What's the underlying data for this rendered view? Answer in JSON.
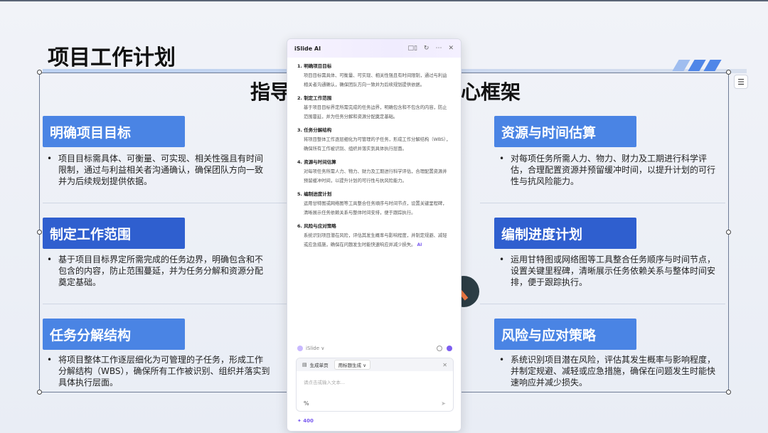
{
  "slide": {
    "title": "项目工作计划",
    "center_title_left": "指导",
    "center_title_right": "心框架",
    "sections_left": [
      {
        "header": "明确项目目标",
        "bullet": "•",
        "body": "项目目标需具体、可衡量、可实现、相关性强且有时间限制，通过与利益相关者沟通确认，确保团队方向一致并为后续规划提供依据。"
      },
      {
        "header": "制定工作范围",
        "bullet": "•",
        "body": "基于项目目标界定所需完成的任务边界，明确包含和不包含的内容，防止范围蔓延，并为任务分解和资源分配奠定基础。"
      },
      {
        "header": "任务分解结构",
        "bullet": "•",
        "body": "将项目整体工作逐层细化为可管理的子任务，形成工作分解结构（WBS），确保所有工作被识别、组织并落实到具体执行层面。"
      }
    ],
    "sections_right": [
      {
        "header": "资源与时间估算",
        "bullet": "•",
        "body": "对每项任务所需人力、物力、财力及工期进行科学评估，合理配置资源并预留缓冲时间，以提升计划的可行性与抗风险能力。"
      },
      {
        "header": "编制进度计划",
        "bullet": "•",
        "body": "运用甘特图或网络图等工具整合任务顺序与时间节点，设置关键里程碑，清晰展示任务依赖关系与整体时间安排，便于跟踪执行。"
      },
      {
        "header": "风险与应对策略",
        "bullet": "•",
        "body": "系统识别项目潜在风险，评估其发生概率与影响程度，并制定规避、减轻或应急措施，确保在问题发生时能快速响应并减少损失。"
      }
    ]
  },
  "ai_panel": {
    "title": "iSlide AI",
    "header_icons": [
      "□▯",
      "↻",
      "⋯",
      "✕"
    ],
    "items": [
      {
        "title": "1. 明确项目目标",
        "body": "项目目标需具体、可衡量、可实现、相关性强且有时间限制，通过与利益相关者沟通确认，确保团队方向一致并为后续规划提供依据。"
      },
      {
        "title": "2. 制定工作范围",
        "body": "基于项目目标界定所需完成的任务边界，明确包含和不包含的内容，防止范围蔓延，并为任务分解和资源分配奠定基础。"
      },
      {
        "title": "3. 任务分解结构",
        "body": "将项目整体工作逐层细化为可管理的子任务，形成工作分解结构（WBS），确保所有工作被识别、组织并落实到具体执行层面。"
      },
      {
        "title": "4. 资源与时间估算",
        "body": "对每项任务所需人力、物力、财力及工期进行科学评估，合理配置资源并预留缓冲时间，以提升计划的可行性与抗风险能力。"
      },
      {
        "title": "5. 编制进度计划",
        "body": "运用甘特图或网络图等工具整合任务顺序与时间节点，设置关键里程碑，清晰展示任务依赖关系与整体时间安排，便于跟踪执行。"
      },
      {
        "title": "6. 风险与应对策略",
        "body": "系统识别项目潜在风险，评估其发生概率与影响程度，并制定规避、减轻或应急措施，确保在问题发生时能快速响应并减少损失。"
      }
    ],
    "ai_tag": "AI",
    "source_label": "iSlide ∨",
    "chip_page": "生成单页",
    "chip_mode": "用标题生成 ∨",
    "chip_close": "✕",
    "placeholder": "请点击或输入文本...",
    "tools_left": "%",
    "tools_send": "➤",
    "credits": "✦ 400"
  },
  "colors": {
    "header_light": "#4a84e4",
    "header_dark": "#2f5fcf",
    "ai_accent": "#7b5cf0"
  }
}
